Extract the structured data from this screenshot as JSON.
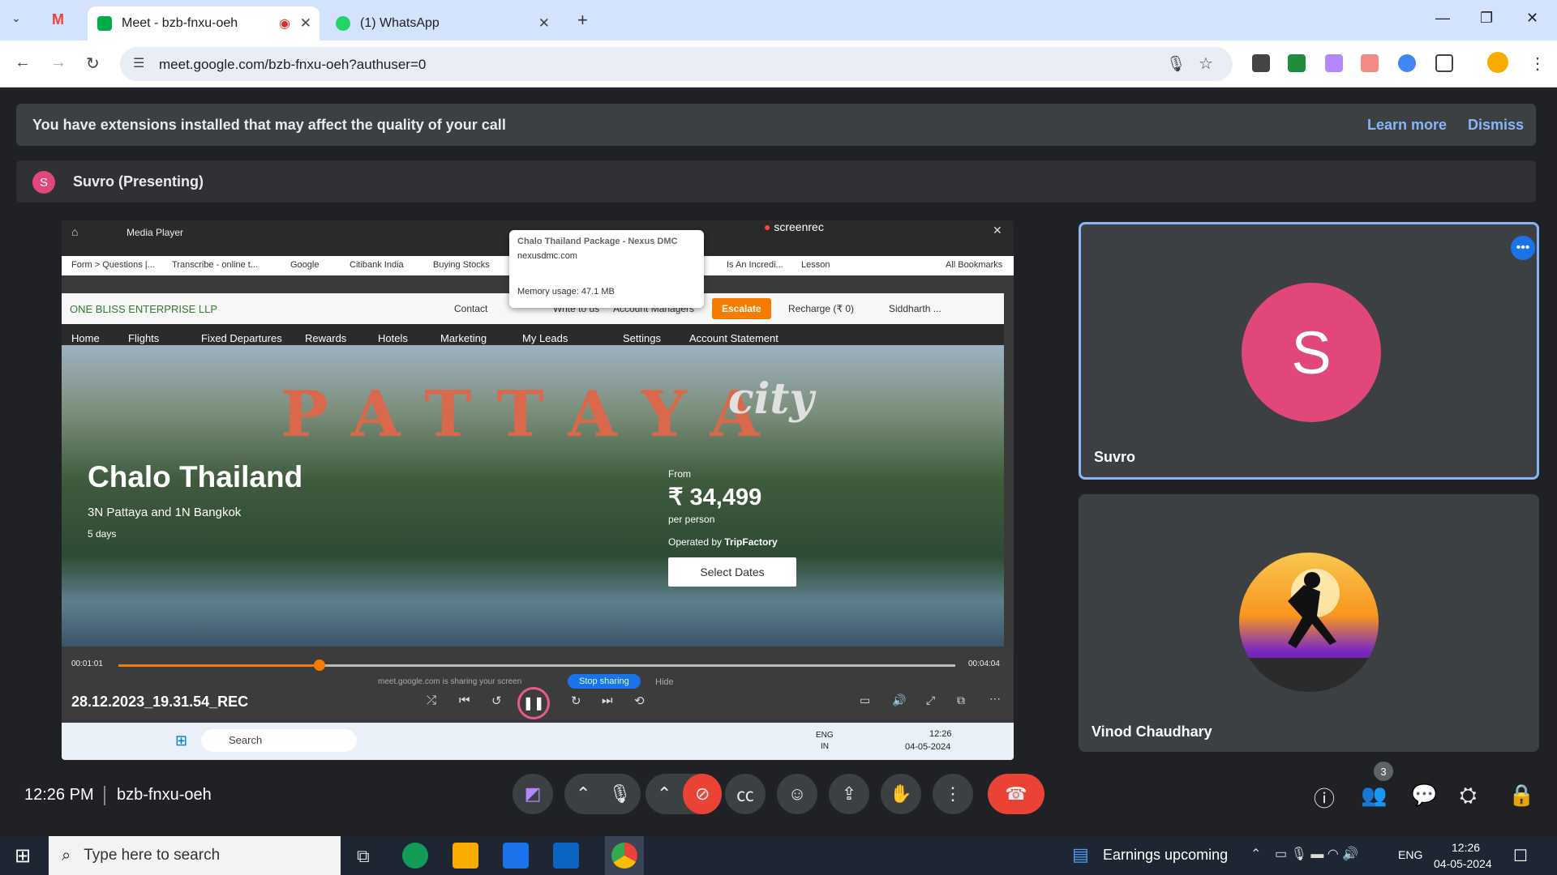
{
  "browser": {
    "tabs": [
      {
        "label": "Meet - bzb-fnxu-oeh",
        "active": true
      },
      {
        "label": "(1) WhatsApp",
        "active": false
      }
    ],
    "url": "meet.google.com/bzb-fnxu-oeh?authuser=0"
  },
  "meet": {
    "banner_text": "You have extensions installed that may affect the quality of your call",
    "learn_more": "Learn more",
    "dismiss": "Dismiss",
    "presenter_initial": "S",
    "presenter_label": "Suvro (Presenting)",
    "time": "12:26 PM",
    "meeting_code": "bzb-fnxu-oeh",
    "participants_count": "3",
    "tiles": [
      {
        "name": "Suvro",
        "initial": "S"
      },
      {
        "name": "Vinod Chaudhary"
      }
    ]
  },
  "shared": {
    "media_player": "Media Player",
    "screenrec": "screenrec",
    "popup_title": "Chalo Thailand Package - Nexus DMC",
    "popup_domain": "nexusdmc.com",
    "popup_memory": "Memory usage: 47.1 MB",
    "bookmarks": [
      "Form > Questions |...",
      "Transcribe - online t...",
      "Google",
      "Citibank India",
      "Buying Stocks",
      "Is An Incredi...",
      "Lesson",
      "All Bookmarks"
    ],
    "company": "ONE BLISS ENTERPRISE LLP",
    "header_links": [
      "Contact",
      "Write to us",
      "Account Managers"
    ],
    "escalate": "Escalate",
    "recharge": "Recharge (₹ 0)",
    "user": "Siddharth ...",
    "nav": [
      "Home",
      "Flights",
      "Fixed Departures",
      "Rewards",
      "Hotels",
      "Marketing",
      "My Leads",
      "Settings",
      "Account Statement"
    ],
    "scene_word1": "PATTAYA",
    "scene_word2": "city",
    "package_title": "Chalo Thailand",
    "package_sub": "3N Pattaya and 1N Bangkok",
    "package_days": "5 days",
    "from_label": "From",
    "price": "₹ 34,499",
    "per_person": "per person",
    "operated_prefix": "Operated by ",
    "operated_by": "TripFactory",
    "select_dates": "Select Dates",
    "time_elapsed": "00:01:01",
    "time_total": "00:04:04",
    "progress": 0.24,
    "file_name": "28.12.2023_19.31.54_REC",
    "sharing_text": "meet.google.com is sharing your screen",
    "stop_sharing": "Stop sharing",
    "hide": "Hide",
    "task_search": "Search",
    "task_lang": "ENG",
    "task_region": "IN",
    "task_time": "12:26",
    "task_date": "04-05-2024"
  },
  "taskbar": {
    "search_placeholder": "Type here to search",
    "news": "Earnings upcoming",
    "lang": "ENG",
    "time": "12:26",
    "date": "04-05-2024"
  },
  "colors": {
    "accent": "#8ab4f8",
    "avatar": "#e2477a",
    "end_call": "#ea4335",
    "cam_off": "#ea4335"
  }
}
